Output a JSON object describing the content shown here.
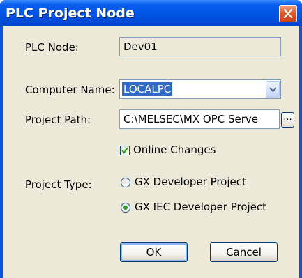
{
  "window": {
    "title": "PLC Project Node",
    "close_icon": "close-icon"
  },
  "form": {
    "plc_node": {
      "label": "PLC Node:",
      "value": "Dev01"
    },
    "computer_name": {
      "label": "Computer Name:",
      "value": "LOCALPC"
    },
    "project_path": {
      "label": "Project Path:",
      "value": "C:\\MELSEC\\MX OPC Serve",
      "browse_label": "..."
    },
    "online_changes": {
      "label": "Online Changes",
      "checked": true
    },
    "project_type": {
      "label": "Project Type:",
      "options": [
        {
          "label": "GX Developer Project",
          "selected": false
        },
        {
          "label": "GX IEC Developer Project",
          "selected": true
        }
      ]
    }
  },
  "buttons": {
    "ok": "OK",
    "cancel": "Cancel"
  },
  "colors": {
    "titlebar": "#0054e3",
    "selection": "#316ac5",
    "radio_selected": "#21a121"
  }
}
